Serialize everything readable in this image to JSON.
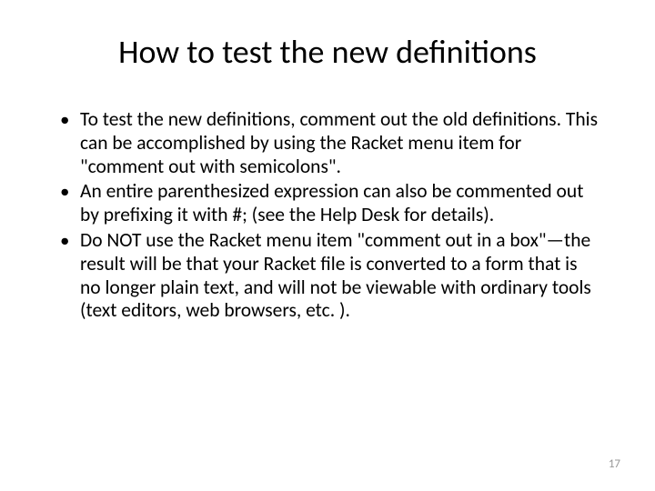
{
  "slide": {
    "title": "How to test the new definitions",
    "bullets": [
      "To test the new definitions, comment out the old definitions.  This can be accomplished by using the Racket menu item for \"comment out with semicolons\".",
      "An entire parenthesized expression can also be commented out by prefixing it with #;  (see the Help Desk for details).",
      "Do NOT use the Racket menu item \"comment out in a box\"—the result will be that your Racket file is converted to a form that is no longer plain text, and will not be viewable with ordinary tools (text editors, web browsers, etc. )."
    ],
    "page_number": "17"
  }
}
